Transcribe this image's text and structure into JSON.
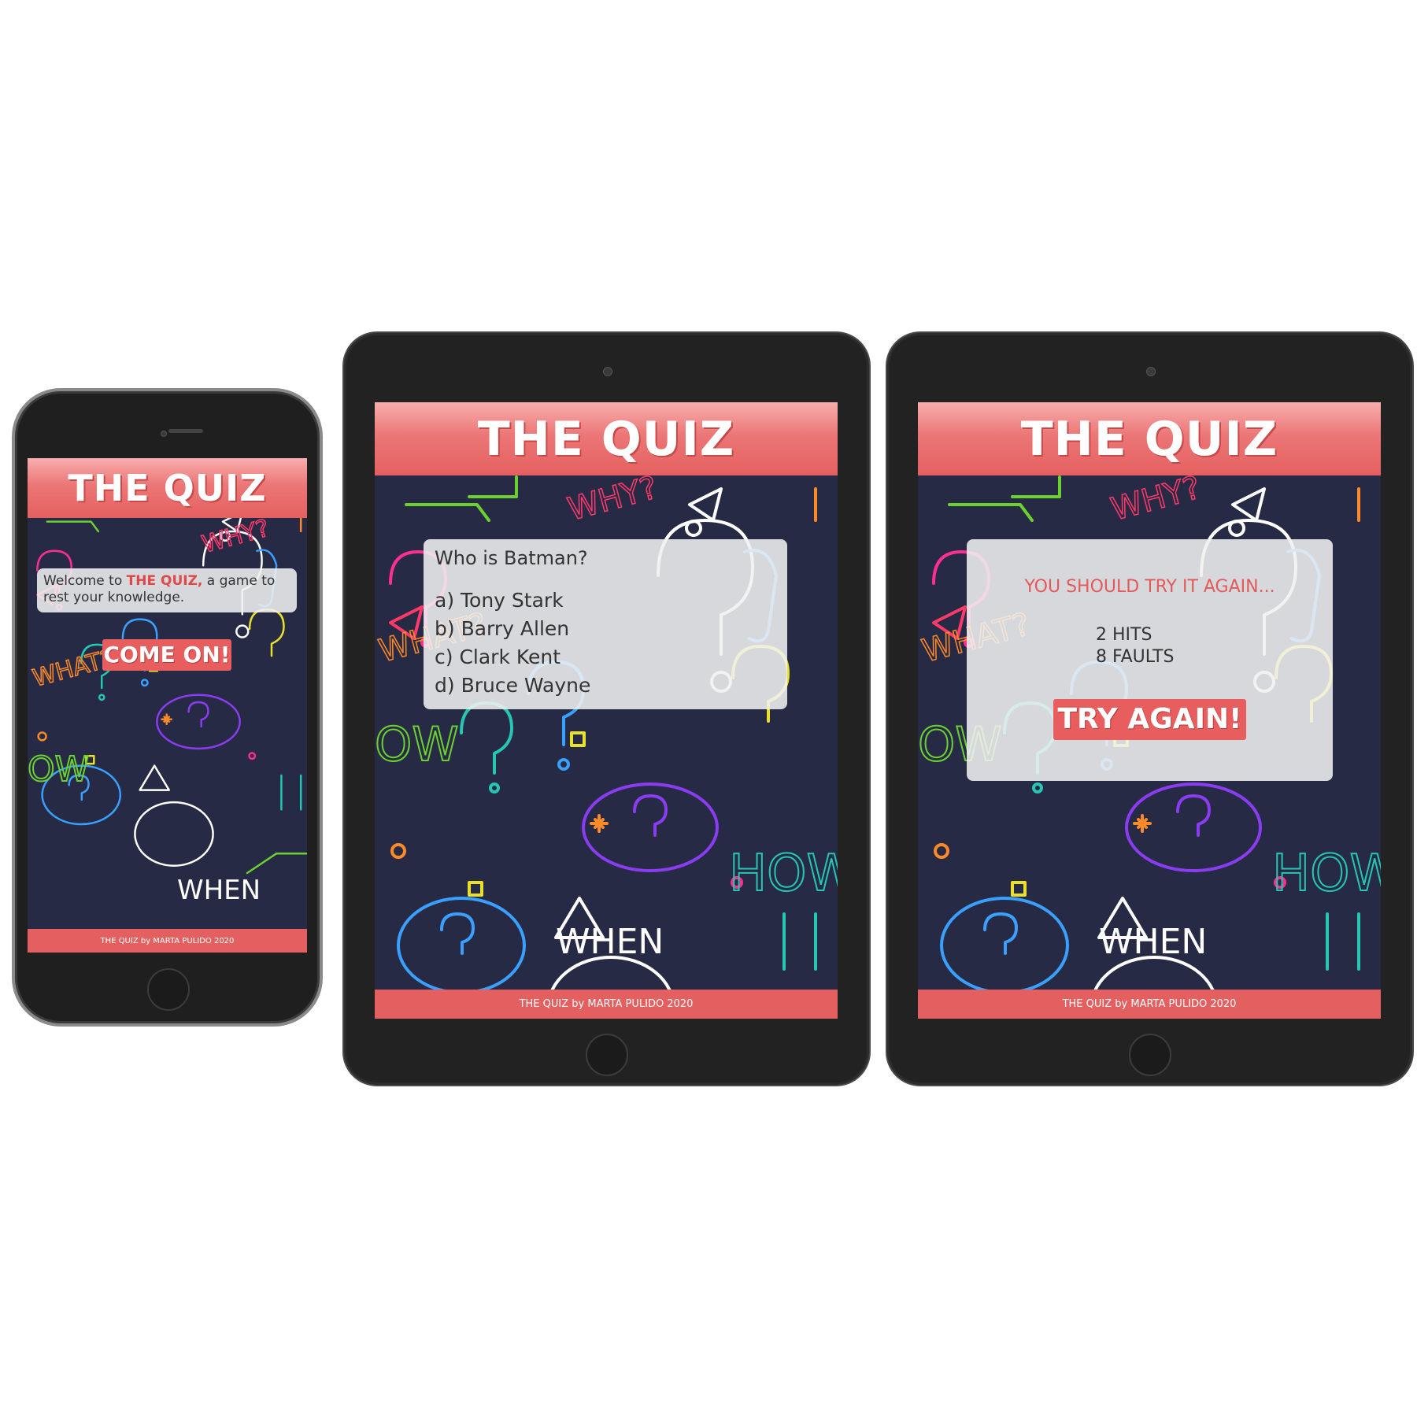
{
  "app": {
    "title": "THE QUIZ",
    "footer": "THE QUIZ by MARTA PULIDO 2020"
  },
  "phone_screen": {
    "welcome_prefix": "Welcome to",
    "welcome_highlight": "THE QUIZ,",
    "welcome_suffix": "a game to rest your knowledge.",
    "button_label": "COME ON!"
  },
  "tablet_question_screen": {
    "question": "Who is Batman?",
    "options": [
      "a) Tony Stark",
      "b) Barry Allen",
      "c) Clark Kent",
      "d) Bruce Wayne"
    ]
  },
  "tablet_result_screen": {
    "message": "YOU SHOULD TRY IT AGAIN...",
    "hits": "2 HITS",
    "faults": "8 FAULTS",
    "button_label": "TRY AGAIN!"
  },
  "background_doodles": [
    "WHY?",
    "WHAT?",
    "HOW",
    "WHEN"
  ],
  "colors": {
    "brand_red": "#e46060",
    "screen_bg": "#272a45",
    "device_body": "#1f1f1f"
  }
}
